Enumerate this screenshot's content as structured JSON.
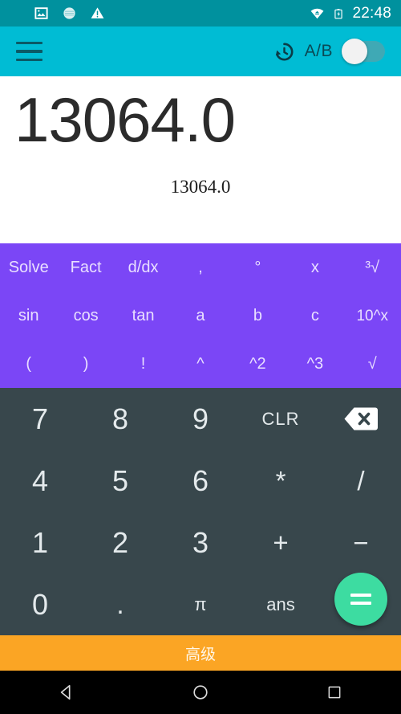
{
  "status_bar": {
    "icons": [
      "image-icon",
      "circle-pattern-icon",
      "warning-triangle-icon"
    ],
    "wifi_icon": "wifi-icon",
    "battery_icon": "battery-charging-icon",
    "clock": "22:48",
    "background_color": "#00919E"
  },
  "app_bar": {
    "menu_icon": "hamburger-menu-icon",
    "history_icon": "history-clock-icon",
    "toggle_label": "A/B",
    "toggle_state": "off",
    "background_color": "#00BCD4"
  },
  "display": {
    "primary_value": "13064.0",
    "secondary_value": "13064.0",
    "background_color": "#FFFFFF"
  },
  "function_pad": {
    "background_color": "#7B46F6",
    "rows": [
      [
        {
          "label": "Solve",
          "name": "solve"
        },
        {
          "label": "Fact",
          "name": "fact"
        },
        {
          "label": "d/dx",
          "name": "ddx"
        },
        {
          "label": ",",
          "name": "comma"
        },
        {
          "label": "°",
          "name": "degree"
        },
        {
          "label": "x",
          "name": "variable-x"
        },
        {
          "label": "³√",
          "name": "cube-root"
        }
      ],
      [
        {
          "label": "sin",
          "name": "sin"
        },
        {
          "label": "cos",
          "name": "cos"
        },
        {
          "label": "tan",
          "name": "tan"
        },
        {
          "label": "a",
          "name": "variable-a"
        },
        {
          "label": "b",
          "name": "variable-b"
        },
        {
          "label": "c",
          "name": "variable-c"
        },
        {
          "label": "10^x",
          "name": "ten-power-x"
        }
      ],
      [
        {
          "label": "(",
          "name": "open-paren"
        },
        {
          "label": ")",
          "name": "close-paren"
        },
        {
          "label": "!",
          "name": "factorial"
        },
        {
          "label": "^",
          "name": "power"
        },
        {
          "label": "^2",
          "name": "square"
        },
        {
          "label": "^3",
          "name": "cube"
        },
        {
          "label": "√",
          "name": "square-root"
        }
      ]
    ]
  },
  "numeric_pad": {
    "background_color": "#38474C",
    "rows": [
      [
        {
          "label": "7",
          "name": "seven"
        },
        {
          "label": "8",
          "name": "eight"
        },
        {
          "label": "9",
          "name": "nine"
        },
        {
          "label": "CLR",
          "name": "clear"
        },
        {
          "label": "backspace-icon",
          "name": "backspace"
        }
      ],
      [
        {
          "label": "4",
          "name": "four"
        },
        {
          "label": "5",
          "name": "five"
        },
        {
          "label": "6",
          "name": "six"
        },
        {
          "label": "*",
          "name": "multiply"
        },
        {
          "label": "/",
          "name": "divide"
        }
      ],
      [
        {
          "label": "1",
          "name": "one"
        },
        {
          "label": "2",
          "name": "two"
        },
        {
          "label": "3",
          "name": "three"
        },
        {
          "label": "+",
          "name": "plus"
        },
        {
          "label": "−",
          "name": "minus"
        }
      ],
      [
        {
          "label": "0",
          "name": "zero"
        },
        {
          "label": ".",
          "name": "decimal-point"
        },
        {
          "label": "π",
          "name": "pi"
        },
        {
          "label": "ans",
          "name": "answer"
        },
        {
          "label": "",
          "name": "equals-spacer"
        }
      ]
    ],
    "equals_button": {
      "icon": "equals-icon",
      "color": "#3DDCA1"
    }
  },
  "ad_bar": {
    "label": "高级",
    "background_color": "#FBA524"
  },
  "nav_bar": {
    "back_icon": "back-triangle-icon",
    "home_icon": "home-circle-icon",
    "recents_icon": "recents-square-icon",
    "background_color": "#000000"
  }
}
